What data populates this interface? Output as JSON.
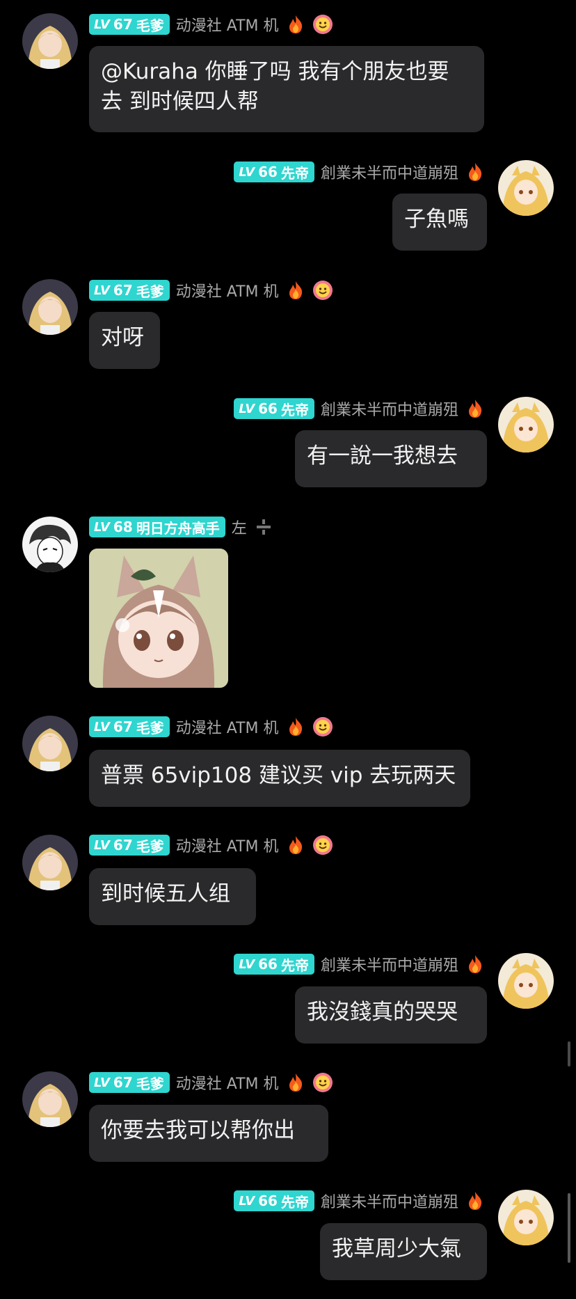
{
  "colors": {
    "background": "#000000",
    "bubble": "#2a2a2c",
    "level_badge": "#2fd5cf",
    "username": "#a9a9a9"
  },
  "messages": [
    {
      "level": "67",
      "title": "毛爹",
      "name": "动漫社 ATM 机",
      "text": "@Kuraha 你睡了吗 我有个朋友也要\n去 到时候四人帮"
    },
    {
      "level": "66",
      "title": "先帝",
      "name": "創業未半而中道崩殂",
      "text": "子魚嗎"
    },
    {
      "level": "67",
      "title": "毛爹",
      "name": "动漫社 ATM 机",
      "text": "对呀"
    },
    {
      "level": "66",
      "title": "先帝",
      "name": "創業未半而中道崩殂",
      "text": "有一說一我想去"
    },
    {
      "level": "68",
      "title": "明日方舟高手",
      "name": "左",
      "sticker": "sticker-image"
    },
    {
      "level": "67",
      "title": "毛爹",
      "name": "动漫社 ATM 机",
      "text": "普票 65vip108 建议买 vip 去玩两天"
    },
    {
      "level": "67",
      "title": "毛爹",
      "name": "动漫社 ATM 机",
      "text": "到时候五人组"
    },
    {
      "level": "66",
      "title": "先帝",
      "name": "創業未半而中道崩殂",
      "text": "我沒錢真的哭哭"
    },
    {
      "level": "67",
      "title": "毛爹",
      "name": "动漫社 ATM 机",
      "text": "你要去我可以帮你出"
    },
    {
      "level": "66",
      "title": "先帝",
      "name": "創業未半而中道崩殂",
      "text": "我草周少大氣"
    }
  ],
  "badge_prefix": "LV",
  "icons": [
    "fire-icon",
    "smiley-flower-icon",
    "minus-plus-icon"
  ]
}
